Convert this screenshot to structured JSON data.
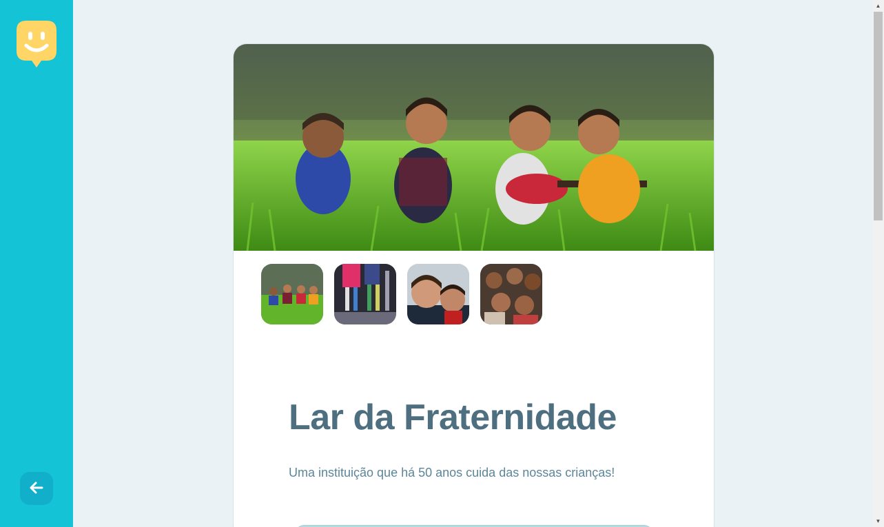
{
  "app": {
    "logo": "happy-face-logo",
    "back_button_icon": "arrow-left-icon",
    "accent_color": "#15c3d6",
    "logo_color": "#ffd666"
  },
  "orphanage": {
    "name": "Lar da Fraternidade",
    "about": "Uma instituição que há 50 anos cuida das nossas crianças!",
    "images": [
      {
        "subject": "kids-in-grass"
      },
      {
        "subject": "kids-legs-colorful-socks"
      },
      {
        "subject": "two-boys-smiling"
      },
      {
        "subject": "group-of-kids"
      }
    ]
  },
  "colors": {
    "title": "#4d6f80",
    "text": "#5c8599",
    "background": "#ebf2f5"
  }
}
